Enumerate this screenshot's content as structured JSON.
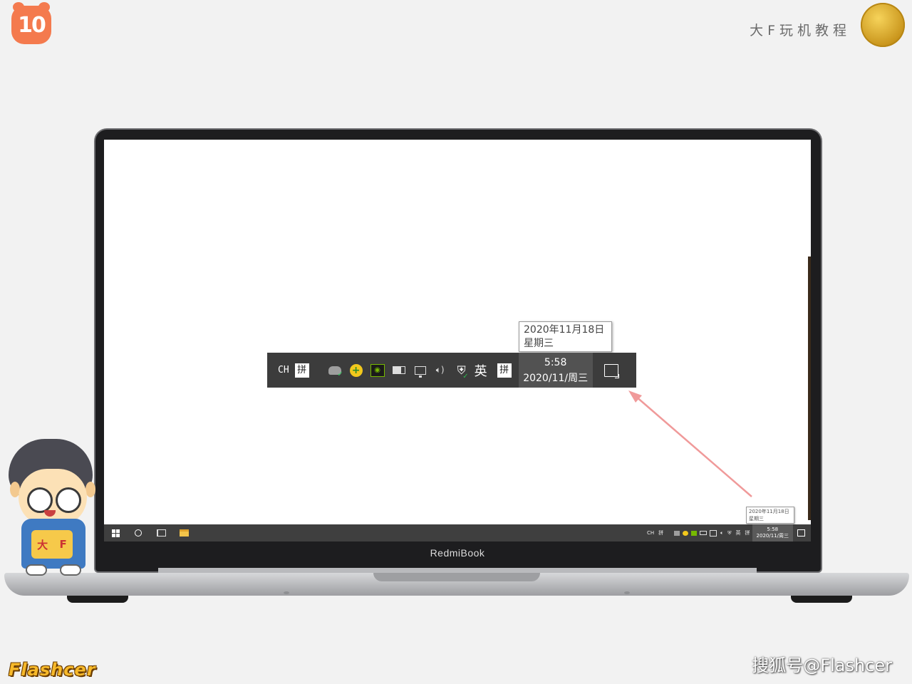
{
  "branding": {
    "logo_text": "10",
    "brand_title": "大F玩机教程",
    "mascot_apron": [
      "大",
      "F"
    ],
    "corner_logo": "Flashcer",
    "watermark": "搜狐号@Flashcer"
  },
  "laptop": {
    "brand": "RedmiBook"
  },
  "taskbar": {
    "start_icon": "windows-logo-icon",
    "search_icon": "cortana-circle-icon",
    "task_view_icon": "task-view-icon",
    "pinned": [
      "file-explorer-icon"
    ],
    "tray": {
      "lang": "CH",
      "ime": "拼",
      "ime_mode": "英",
      "time": "5:58",
      "date": "2020/11/周三",
      "tooltip_line1": "2020年11月18日",
      "tooltip_line2": "星期三"
    }
  },
  "zoomed_tray": {
    "lang": "CH",
    "ime_left": "拼",
    "icons": [
      "cloud-sync-check-icon",
      "green-plus-icon",
      "nvidia-icon",
      "battery-icon",
      "network-monitor-icon",
      "volume-icon",
      "security-shield-icon"
    ],
    "ime_mode": "英",
    "ime_right": "拼",
    "time": "5:58",
    "date": "2020/11/周三",
    "notification_icon": "action-center-icon"
  },
  "tooltip": {
    "line1": "2020年11月18日",
    "line2": "星期三"
  },
  "colors": {
    "taskbar": "#3c3c3c",
    "clock_highlight": "#525252",
    "arrow": "#f09a9a",
    "logo": "#f47a4e"
  }
}
